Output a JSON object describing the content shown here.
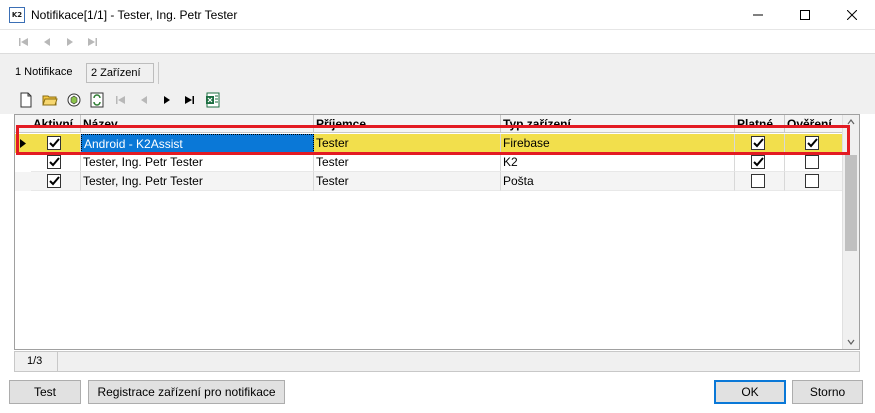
{
  "window": {
    "title": "Notifikace[1/1] - Tester, Ing. Petr Tester",
    "app_icon_text": "K2",
    "minimize_glyph": "—",
    "maximize_glyph": "☐",
    "close_glyph": "✕"
  },
  "tabs": [
    {
      "label": "1 Notifikace",
      "active": false
    },
    {
      "label": "2 Zařízení",
      "active": true
    }
  ],
  "toolbar_icons": [
    "new-record-icon",
    "open-folder-icon",
    "refresh-icon",
    "sync-icon",
    "first-record-icon",
    "previous-record-icon",
    "next-record-icon",
    "last-record-icon",
    "excel-export-icon"
  ],
  "grid": {
    "columns": [
      "Aktivní",
      "Název",
      "Příjemce",
      "Typ zařízení",
      "Platné",
      "Ověření"
    ],
    "rows": [
      {
        "aktivni": true,
        "nazev": "Android - K2Assist",
        "prijemce": "Tester",
        "typ": "Firebase",
        "platne": true,
        "overeni": true,
        "selected": true
      },
      {
        "aktivni": true,
        "nazev": "Tester, Ing. Petr Tester",
        "prijemce": "Tester",
        "typ": "K2",
        "platne": true,
        "overeni": false,
        "selected": false
      },
      {
        "aktivni": true,
        "nazev": "Tester, Ing. Petr Tester",
        "prijemce": "Tester",
        "typ": "Pošta",
        "platne": false,
        "overeni": false,
        "selected": false
      }
    ]
  },
  "status": {
    "record_count": "1/3"
  },
  "buttons": {
    "test": "Test",
    "register": "Registrace zařízení pro notifikace",
    "ok": "OK",
    "cancel": "Storno"
  },
  "colors": {
    "selected_row": "#f2df4c",
    "focus_cell": "#0a78d7",
    "highlight_border": "#e31b23"
  }
}
